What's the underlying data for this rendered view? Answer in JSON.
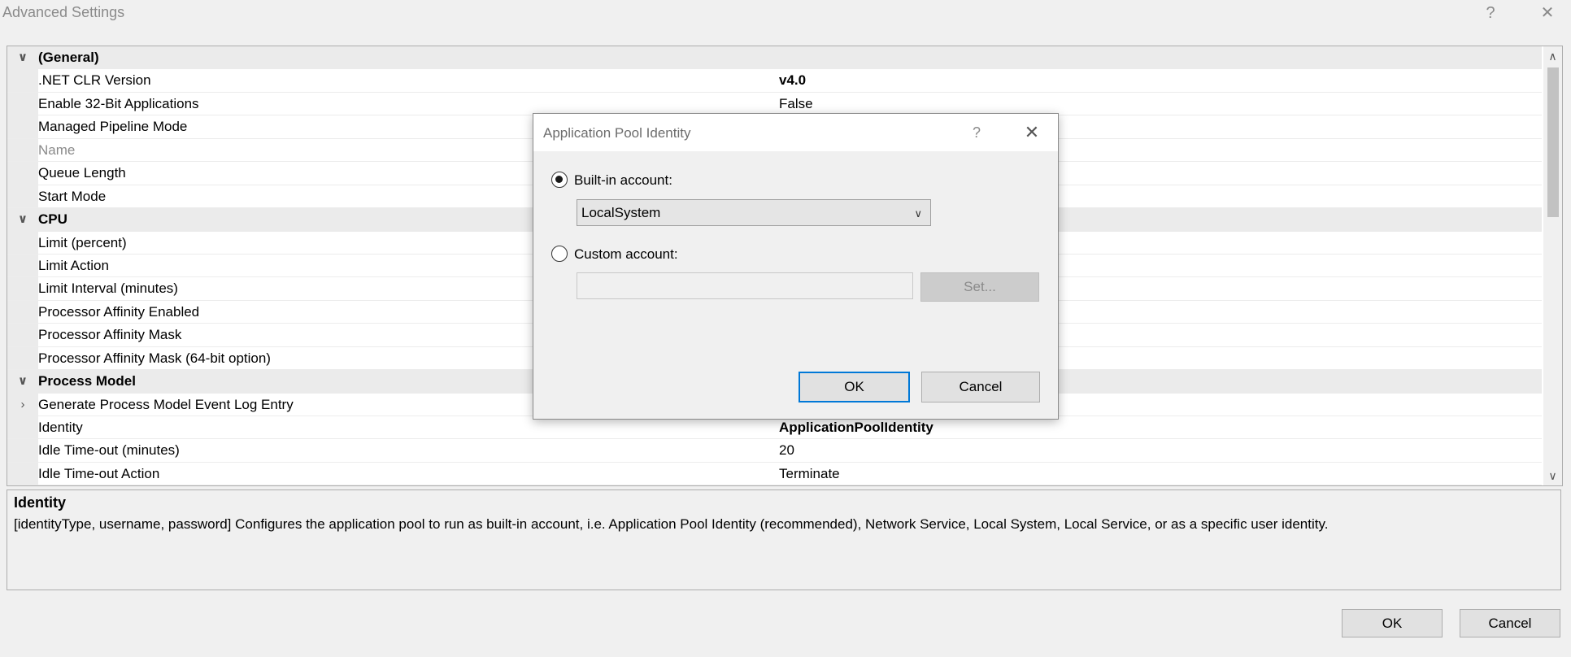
{
  "window": {
    "title": "Advanced Settings",
    "help_glyph": "?",
    "close_glyph": "✕"
  },
  "grid": {
    "rows": [
      {
        "type": "category",
        "label": "(General)",
        "chevron": "∨"
      },
      {
        "type": "prop",
        "name": ".NET CLR Version",
        "value": "v4.0",
        "value_bold": true
      },
      {
        "type": "prop",
        "name": "Enable 32-Bit Applications",
        "value": "False"
      },
      {
        "type": "prop",
        "name": "Managed Pipeline Mode",
        "value": ""
      },
      {
        "type": "prop",
        "name": "Name",
        "value": "",
        "disabled": true
      },
      {
        "type": "prop",
        "name": "Queue Length",
        "value": ""
      },
      {
        "type": "prop",
        "name": "Start Mode",
        "value": ""
      },
      {
        "type": "category",
        "label": "CPU",
        "chevron": "∨"
      },
      {
        "type": "prop",
        "name": "Limit (percent)",
        "value": ""
      },
      {
        "type": "prop",
        "name": "Limit Action",
        "value": ""
      },
      {
        "type": "prop",
        "name": "Limit Interval (minutes)",
        "value": ""
      },
      {
        "type": "prop",
        "name": "Processor Affinity Enabled",
        "value": ""
      },
      {
        "type": "prop",
        "name": "Processor Affinity Mask",
        "value": ""
      },
      {
        "type": "prop",
        "name": "Processor Affinity Mask (64-bit option)",
        "value": ""
      },
      {
        "type": "category",
        "label": "Process Model",
        "chevron": "∨"
      },
      {
        "type": "prop",
        "name": "Generate Process Model Event Log Entry",
        "value": "",
        "expandable": true,
        "chevron": "›"
      },
      {
        "type": "prop",
        "name": "Identity",
        "value": "ApplicationPoolIdentity",
        "value_bold": true
      },
      {
        "type": "prop",
        "name": "Idle Time-out (minutes)",
        "value": "20"
      },
      {
        "type": "prop",
        "name": "Idle Time-out Action",
        "value": "Terminate"
      }
    ],
    "scroll_up_glyph": "∧",
    "scroll_down_glyph": "∨"
  },
  "description": {
    "title": "Identity",
    "text": "[identityType, username, password] Configures the application pool to run as built-in account, i.e. Application Pool Identity (recommended), Network Service, Local System, Local Service, or as a specific user identity."
  },
  "footer": {
    "ok_label": "OK",
    "cancel_label": "Cancel"
  },
  "dialog": {
    "title": "Application Pool Identity",
    "help_glyph": "?",
    "close_glyph": "✕",
    "builtin_label": "Built-in account:",
    "builtin_selected": true,
    "builtin_value": "LocalSystem",
    "dropdown_glyph": "∨",
    "custom_label": "Custom account:",
    "custom_selected": false,
    "custom_value": "",
    "set_label": "Set...",
    "ok_label": "OK",
    "cancel_label": "Cancel"
  },
  "colors": {
    "accent": "#0078d7",
    "category_bg": "#ebebeb",
    "disabled_text": "#8a8a8a"
  }
}
